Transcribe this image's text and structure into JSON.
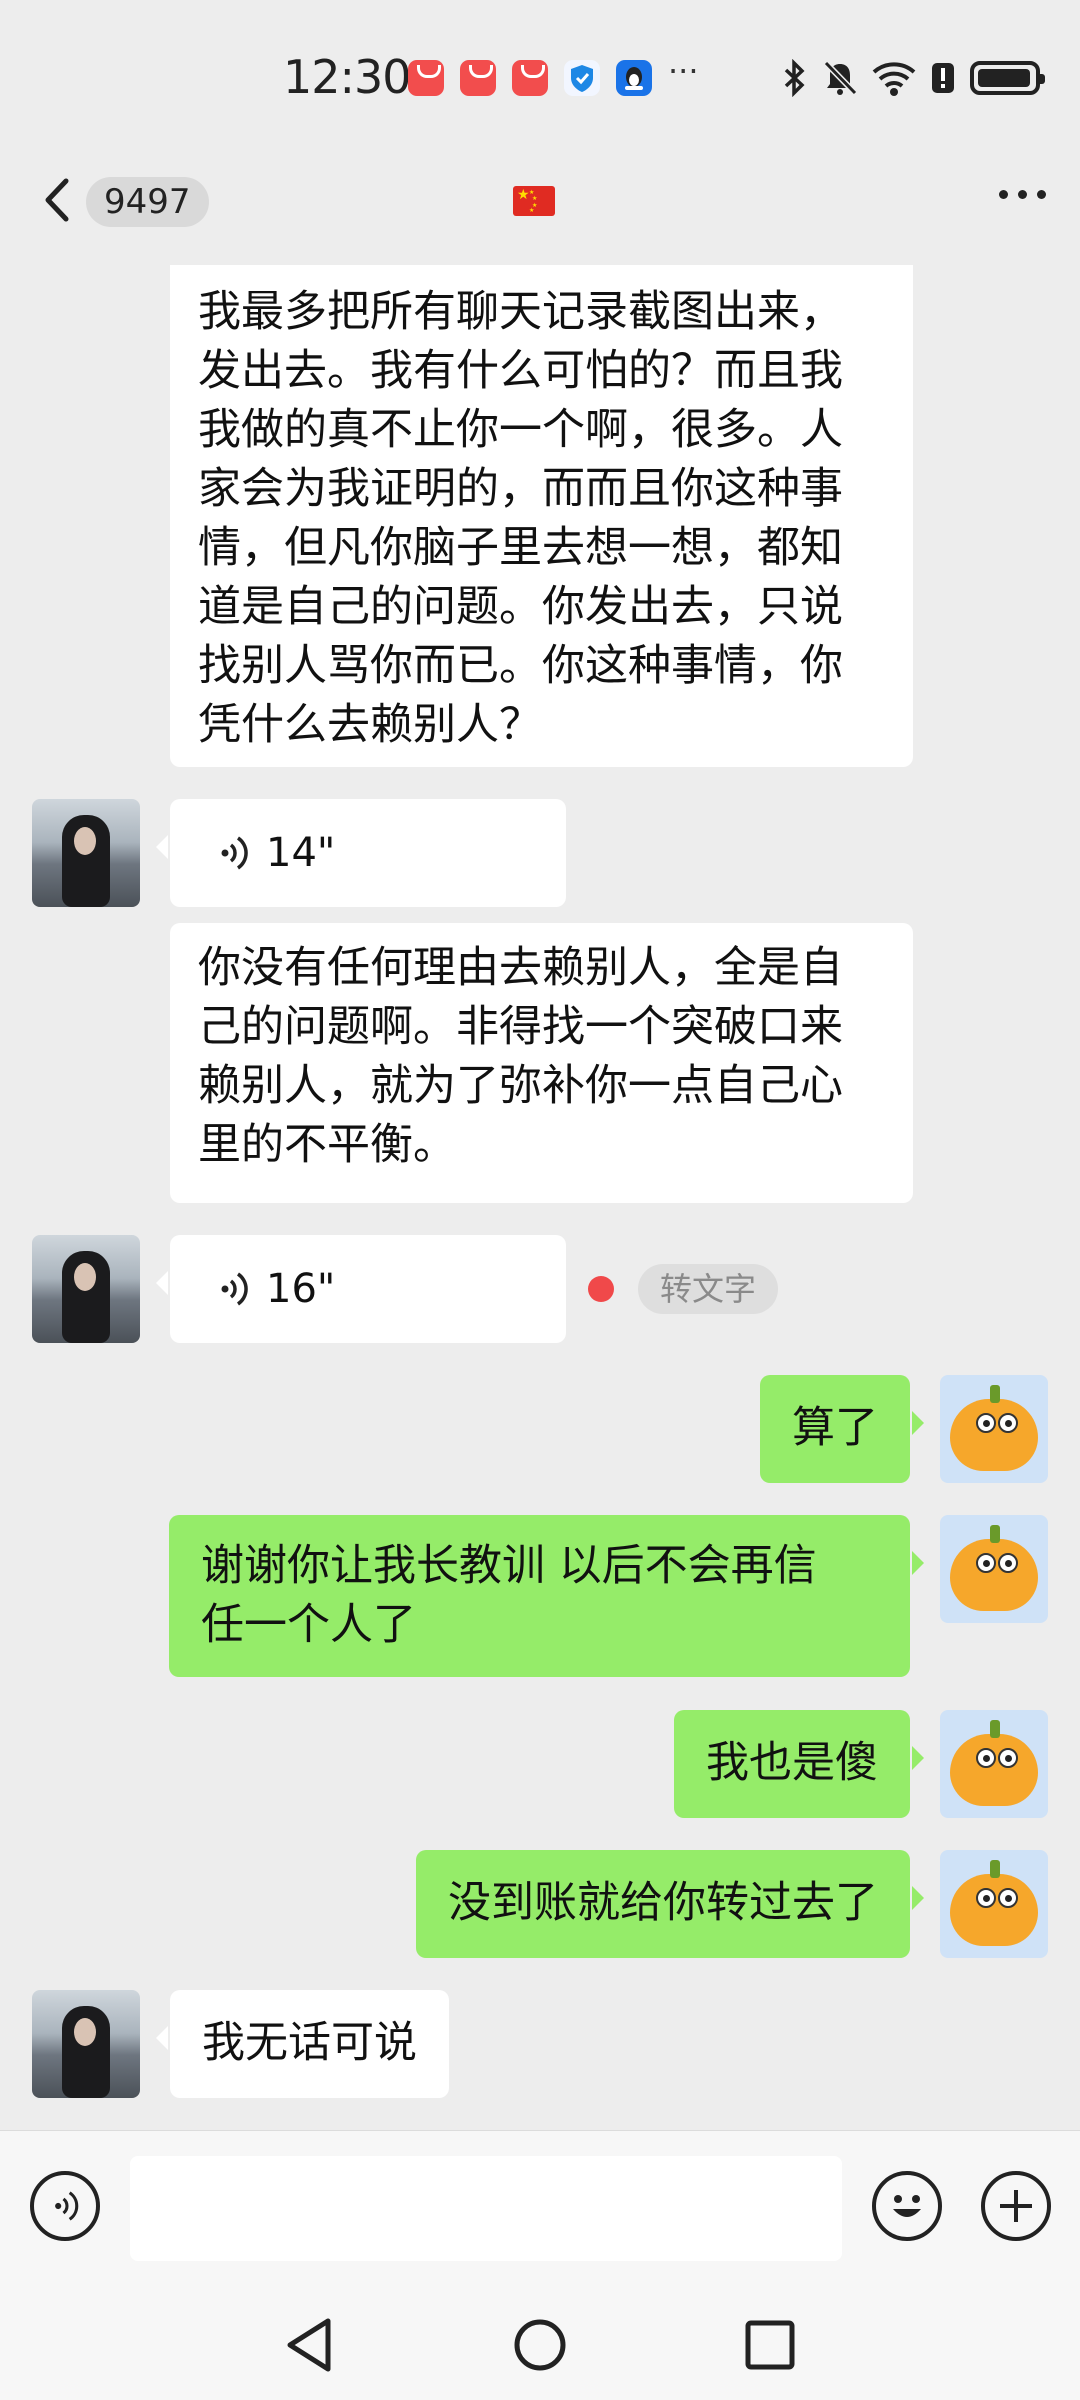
{
  "status_bar": {
    "time": "12:30",
    "notification_icons": [
      "huawei-appgallery-icon",
      "huawei-appgallery-icon",
      "huawei-appgallery-icon",
      "shield-icon",
      "qq-icon"
    ],
    "more": "···",
    "system_icons": [
      "bluetooth-icon",
      "mute-icon",
      "wifi-icon",
      "alert-icon",
      "battery-icon"
    ]
  },
  "header": {
    "unread_count": "9497",
    "title_flag": "china-flag-icon"
  },
  "messages": [
    {
      "sender": "her",
      "type": "text",
      "text_lines": [
        "我最多把所有聊天记录截图出来，",
        "发出去。我有什么可怕的？而且我",
        "我做的真不止你一个啊，很多。人",
        "家会为我证明的，而而且你这种事",
        "情，但凡你脑子里去想一想，都知",
        "道是自己的问题。你发出去，只说",
        "找别人骂你而已。你这种事情，你",
        "凭什么去赖别人？"
      ]
    },
    {
      "sender": "her",
      "type": "voice",
      "duration": "14\""
    },
    {
      "sender": "her",
      "type": "text",
      "text_lines": [
        "你没有任何理由去赖别人，全是自",
        "己的问题啊。非得找一个突破口来",
        "赖别人，就为了弥补你一点自己心",
        "里的不平衡。"
      ]
    },
    {
      "sender": "her",
      "type": "voice",
      "duration": "16\"",
      "convert_label": "转文字"
    },
    {
      "sender": "me",
      "type": "text",
      "text_lines": [
        "算了"
      ]
    },
    {
      "sender": "me",
      "type": "text",
      "text_lines": [
        "谢谢你让我长教训 以后不会再信",
        "任一个人了"
      ]
    },
    {
      "sender": "me",
      "type": "text",
      "text_lines": [
        "我也是傻"
      ]
    },
    {
      "sender": "me",
      "type": "text",
      "text_lines": [
        "没到账就给你转过去了"
      ]
    },
    {
      "sender": "her",
      "type": "text",
      "text_lines": [
        "我无话可说"
      ]
    }
  ],
  "colors": {
    "background": "#ededed",
    "my_bubble": "#95ec69",
    "her_bubble": "#ffffff",
    "unread_dot": "#f0494a"
  }
}
